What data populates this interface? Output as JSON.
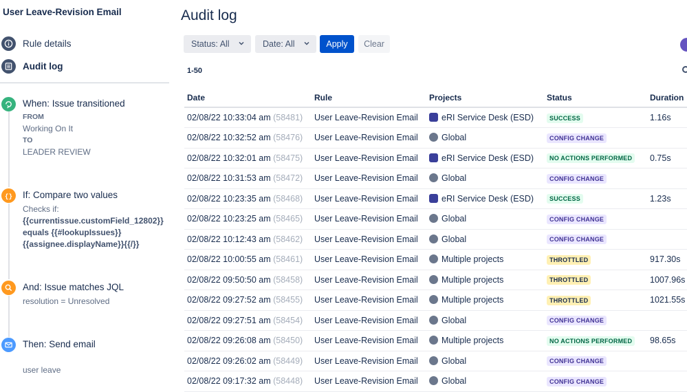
{
  "rule_name": "User Leave-Revision Email",
  "nav": [
    {
      "label": "Rule details",
      "icon": "info-icon",
      "active": false
    },
    {
      "label": "Audit log",
      "icon": "list-icon",
      "active": true
    }
  ],
  "components": {
    "trigger": {
      "title": "When: Issue transitioned",
      "from_label": "FROM",
      "from_value": "Working On It",
      "to_label": "TO",
      "to_value": "LEADER REVIEW",
      "color": "#36b37e"
    },
    "condition": {
      "title": "If: Compare two values",
      "checks_label": "Checks if:",
      "line1": "{{currentissue.customField_12802}}",
      "line2": "equals {{#lookupIssues}}",
      "line3": "{{assignee.displayName}}{{/}}",
      "color": "#ff991f"
    },
    "jql": {
      "title": "And: Issue matches JQL",
      "query": "resolution = Unresolved",
      "color": "#ff991f"
    },
    "action": {
      "title": "Then: Send email",
      "subject": "user leave",
      "color": "#4c9aff"
    }
  },
  "main": {
    "title": "Audit log",
    "filters": {
      "status": "Status: All",
      "date": "Date: All",
      "apply": "Apply",
      "clear": "Clear"
    },
    "range": "1-50",
    "columns": [
      "Date",
      "Rule",
      "Projects",
      "Status",
      "Duration"
    ],
    "rows": [
      {
        "date": "02/08/22 10:33:04 am",
        "id": "(58481)",
        "rule": "User Leave-Revision Email",
        "project": "eRI Service Desk (ESD)",
        "project_icon": "service-desk-icon",
        "status": "SUCCESS",
        "status_kind": "success",
        "duration": "1.16s"
      },
      {
        "date": "02/08/22 10:32:52 am",
        "id": "(58476)",
        "rule": "User Leave-Revision Email",
        "project": "Global",
        "project_icon": "global-icon",
        "status": "CONFIG CHANGE",
        "status_kind": "config",
        "duration": ""
      },
      {
        "date": "02/08/22 10:32:01 am",
        "id": "(58475)",
        "rule": "User Leave-Revision Email",
        "project": "eRI Service Desk (ESD)",
        "project_icon": "service-desk-icon",
        "status": "NO ACTIONS PERFORMED",
        "status_kind": "noaction",
        "duration": "0.75s"
      },
      {
        "date": "02/08/22 10:31:53 am",
        "id": "(58472)",
        "rule": "User Leave-Revision Email",
        "project": "Global",
        "project_icon": "global-icon",
        "status": "CONFIG CHANGE",
        "status_kind": "config",
        "duration": ""
      },
      {
        "date": "02/08/22 10:23:35 am",
        "id": "(58468)",
        "rule": "User Leave-Revision Email",
        "project": "eRI Service Desk (ESD)",
        "project_icon": "service-desk-icon",
        "status": "SUCCESS",
        "status_kind": "success",
        "duration": "1.23s"
      },
      {
        "date": "02/08/22 10:23:25 am",
        "id": "(58465)",
        "rule": "User Leave-Revision Email",
        "project": "Global",
        "project_icon": "global-icon",
        "status": "CONFIG CHANGE",
        "status_kind": "config",
        "duration": ""
      },
      {
        "date": "02/08/22 10:12:43 am",
        "id": "(58462)",
        "rule": "User Leave-Revision Email",
        "project": "Global",
        "project_icon": "global-icon",
        "status": "CONFIG CHANGE",
        "status_kind": "config",
        "duration": ""
      },
      {
        "date": "02/08/22 10:00:55 am",
        "id": "(58461)",
        "rule": "User Leave-Revision Email",
        "project": "Multiple projects",
        "project_icon": "global-icon",
        "status": "THROTTLED",
        "status_kind": "throttled",
        "duration": "917.30s"
      },
      {
        "date": "02/08/22 09:50:50 am",
        "id": "(58458)",
        "rule": "User Leave-Revision Email",
        "project": "Multiple projects",
        "project_icon": "global-icon",
        "status": "THROTTLED",
        "status_kind": "throttled",
        "duration": "1007.96s"
      },
      {
        "date": "02/08/22 09:27:52 am",
        "id": "(58455)",
        "rule": "User Leave-Revision Email",
        "project": "Multiple projects",
        "project_icon": "global-icon",
        "status": "THROTTLED",
        "status_kind": "throttled",
        "duration": "1021.55s"
      },
      {
        "date": "02/08/22 09:27:51 am",
        "id": "(58454)",
        "rule": "User Leave-Revision Email",
        "project": "Global",
        "project_icon": "global-icon",
        "status": "CONFIG CHANGE",
        "status_kind": "config",
        "duration": ""
      },
      {
        "date": "02/08/22 09:26:08 am",
        "id": "(58450)",
        "rule": "User Leave-Revision Email",
        "project": "Multiple projects",
        "project_icon": "global-icon",
        "status": "NO ACTIONS PERFORMED",
        "status_kind": "noaction",
        "duration": "98.65s"
      },
      {
        "date": "02/08/22 09:26:02 am",
        "id": "(58449)",
        "rule": "User Leave-Revision Email",
        "project": "Global",
        "project_icon": "global-icon",
        "status": "CONFIG CHANGE",
        "status_kind": "config",
        "duration": ""
      },
      {
        "date": "02/08/22 09:17:32 am",
        "id": "(58448)",
        "rule": "User Leave-Revision Email",
        "project": "Global",
        "project_icon": "global-icon",
        "status": "CONFIG CHANGE",
        "status_kind": "config",
        "duration": ""
      }
    ]
  }
}
